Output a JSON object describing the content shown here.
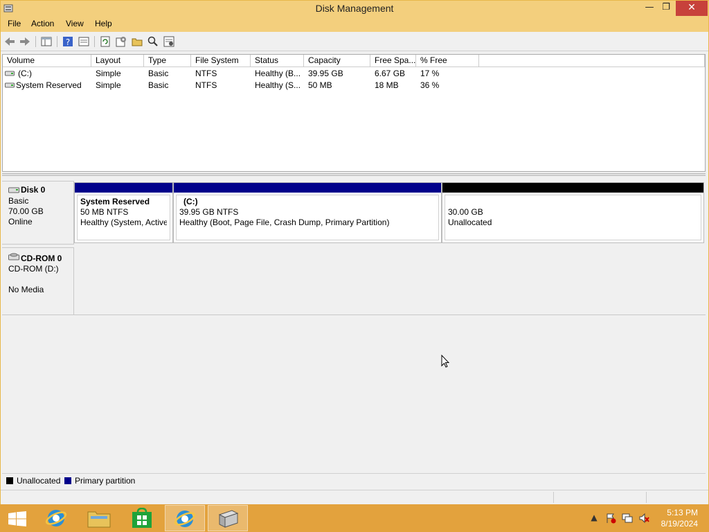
{
  "window": {
    "title": "Disk Management",
    "minimize_glyph": "—",
    "restore_glyph": "❐",
    "close_glyph": "✕"
  },
  "menu": [
    "File",
    "Action",
    "View",
    "Help"
  ],
  "toolbar_icons": [
    "back-icon",
    "forward-icon",
    "show-hide-console-tree-icon",
    "help-icon",
    "properties-icon",
    "refresh-icon",
    "settings-icon",
    "open-icon",
    "search-icon",
    "rescan-icon"
  ],
  "volumes": {
    "columns": [
      "Volume",
      "Layout",
      "Type",
      "File System",
      "Status",
      "Capacity",
      "Free Spa...",
      "% Free"
    ],
    "rows": [
      [
        "(C:)",
        "Simple",
        "Basic",
        "NTFS",
        "Healthy (B...",
        "39.95 GB",
        "6.67 GB",
        "17 %"
      ],
      [
        "System Reserved",
        "Simple",
        "Basic",
        "NTFS",
        "Healthy (S...",
        "50 MB",
        "18 MB",
        "36 %"
      ]
    ]
  },
  "disks": {
    "disk0": {
      "name": "Disk 0",
      "type": "Basic",
      "size": "70.00 GB",
      "state": "Online",
      "partitions": [
        {
          "title": "System Reserved",
          "size": "50 MB NTFS",
          "status": "Healthy (System, Active,"
        },
        {
          "title": "(C:)",
          "size": "39.95 GB NTFS",
          "status": "Healthy (Boot, Page File, Crash Dump, Primary Partition)"
        },
        {
          "title": "",
          "size": "30.00 GB",
          "status": "Unallocated"
        }
      ]
    },
    "cdrom0": {
      "name": "CD-ROM 0",
      "drive": "CD-ROM (D:)",
      "media": "No Media"
    }
  },
  "legend": {
    "unallocated": "Unallocated",
    "primary": "Primary partition"
  },
  "colors": {
    "primary_partition": "#00008b",
    "unallocated": "#000000",
    "title_bar": "#f3cf7d",
    "taskbar": "#e3a23d",
    "close_button": "#c7413b"
  },
  "taskbar": {
    "apps": [
      "start-button",
      "ie-icon",
      "file-explorer-icon",
      "store-icon",
      "ie-active-icon",
      "server-manager-icon"
    ],
    "tray": [
      "show-hidden-icons",
      "action-center-icon",
      "network-icon",
      "volume-muted-icon"
    ],
    "time": "5:13 PM",
    "date": "8/19/2024"
  }
}
